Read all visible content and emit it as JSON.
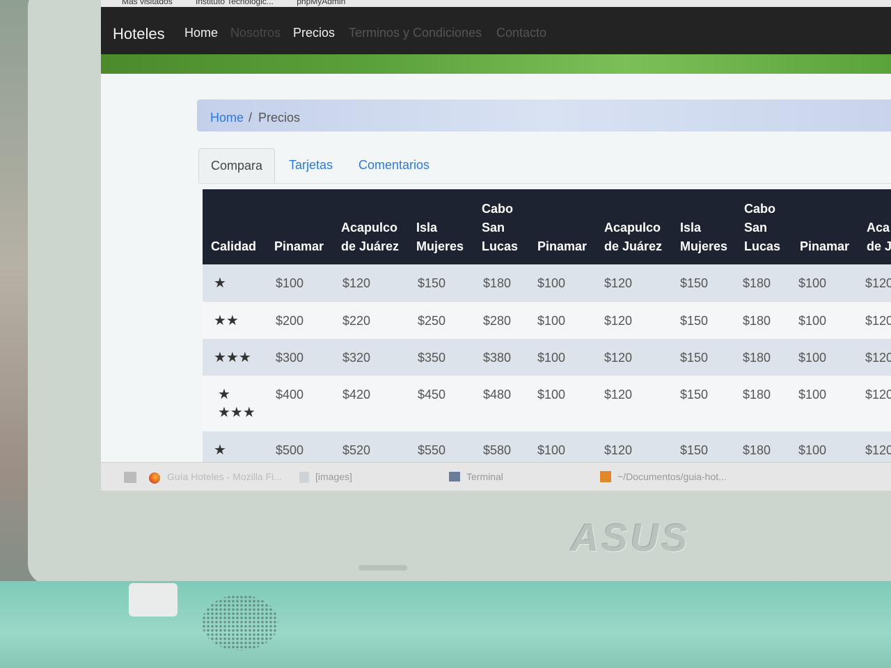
{
  "bookmarks": [
    "Más visitados",
    "Instituto Tecnológic...",
    "phpMyAdmin"
  ],
  "navbar": {
    "brand": "Hoteles",
    "links": [
      "Home",
      "Nosotros",
      "Precios",
      "Terminos y Condiciones",
      "Contacto"
    ]
  },
  "breadcrumb": {
    "home": "Home",
    "separator": "/",
    "current": "Precios"
  },
  "tabs": [
    "Compara",
    "Tarjetas",
    "Comentarios"
  ],
  "table": {
    "headers": [
      "Calidad",
      "Pinamar",
      "Acapulco de Juárez",
      "Isla Mujeres",
      "Cabo San Lucas",
      "Pinamar",
      "Acapulco de Juárez",
      "Isla Mujeres",
      "Cabo San Lucas",
      "Pinamar",
      "Aca de J"
    ],
    "rows": [
      {
        "stars": 1,
        "values": [
          "$100",
          "$120",
          "$150",
          "$180",
          "$100",
          "$120",
          "$150",
          "$180",
          "$100",
          "$120"
        ]
      },
      {
        "stars": 2,
        "values": [
          "$200",
          "$220",
          "$250",
          "$280",
          "$100",
          "$120",
          "$150",
          "$180",
          "$100",
          "$120"
        ]
      },
      {
        "stars": 3,
        "values": [
          "$300",
          "$320",
          "$350",
          "$380",
          "$100",
          "$120",
          "$150",
          "$180",
          "$100",
          "$120"
        ]
      },
      {
        "stars": 4,
        "values": [
          "$400",
          "$420",
          "$450",
          "$480",
          "$100",
          "$120",
          "$150",
          "$180",
          "$100",
          "$120"
        ]
      },
      {
        "stars": 1,
        "values": [
          "$500",
          "$520",
          "$550",
          "$580",
          "$100",
          "$120",
          "$150",
          "$180",
          "$100",
          "$120"
        ]
      }
    ]
  },
  "taskbar": {
    "items": [
      "Guía Hoteles - Mozilla Fi...",
      "[images]",
      "Terminal",
      "~/Documentos/guia-hot..."
    ]
  },
  "hardware": {
    "logo": "ASUS"
  }
}
